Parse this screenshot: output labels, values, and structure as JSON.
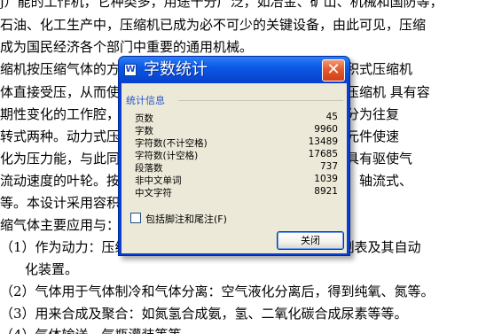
{
  "document": {
    "lines": [
      "j）能的工作机，它种类多，用途十分广泛，如冶金、矿山、机械和国防等，",
      "石油、化工生产中，压缩机已成为必不可少的关键设备，由此可见，压缩",
      "成为国民经济各个部门中重要的通用机械。",
      "缩机按压缩气体的方式不同分为容积式和速度式两大类。容积式压缩机",
      "体直接受压，从而使气体的压力提高，体积缩小，例如活塞压缩机 具有容",
      "期性变化的工作腔，根据运动方式的不同，容积式压缩机可分为往复",
      "转式两种。动力式压缩机是使气体获得高速，然后通过扩压元件使速",
      "化为压力能，与此同时气体的压力得到提高。动力式压缩机具有驱使气",
      "流动速度的叶轮。按气体流动的方向可将动力式分为离心式、轴流式、",
      "等。本设计采用容积式往复活塞压缩机。",
      "缩气体主要应用与：",
      "（1）作为动力：压缩空气可作为动力，用于风动工具、控制表及其自动",
      "化装置。",
      "（2）气体用于气体制冷和气体分离：空气液化分离后，得到纯氧、氮等。",
      "（3）用来合成及聚合：如氮氢合成氨，氢、二氧化碳合成尿素等等。",
      "（4）气体输送，气瓶灌装等等。"
    ]
  },
  "dialog": {
    "title": "字数统计",
    "group_label": "统计信息",
    "stats": [
      {
        "label": "页数",
        "value": "45"
      },
      {
        "label": "字数",
        "value": "9960"
      },
      {
        "label": "字符数(不计空格)",
        "value": "13489"
      },
      {
        "label": "字符数(计空格)",
        "value": "17685"
      },
      {
        "label": "段落数",
        "value": "737"
      },
      {
        "label": "非中文单词",
        "value": "1039"
      },
      {
        "label": "中文字符",
        "value": "8921"
      }
    ],
    "checkbox_label": "包括脚注和尾注(F)",
    "checkbox_checked": false,
    "close_button_label": "关闭",
    "close_icon": "close-icon",
    "colors": {
      "titlebar": "#0a59e6",
      "client": "#ece9d8",
      "close": "#e45a2d"
    }
  }
}
